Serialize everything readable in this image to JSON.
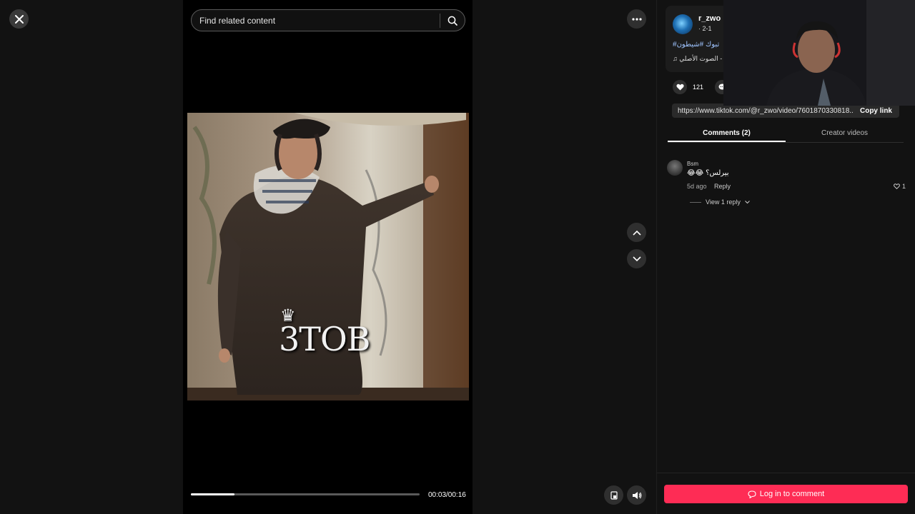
{
  "search": {
    "placeholder": "Find related content"
  },
  "player": {
    "watermark": "3TOB",
    "current_time": "00:03",
    "duration": "00:16",
    "time_label": "00:03/00:16",
    "progress": 0.19
  },
  "author": {
    "username": "r_zwo",
    "date": "· 2-1",
    "hashtags": "#تبوك #شيطون",
    "sound": "الصوت الأصلي -"
  },
  "stats": {
    "likes": "121"
  },
  "share": {
    "url": "https://www.tiktok.com/@r_zwo/video/7601870330818...",
    "copy_label": "Copy link"
  },
  "tabs": [
    {
      "label": "Comments (2)",
      "active": true
    },
    {
      "label": "Creator videos",
      "active": false
    }
  ],
  "comments": [
    {
      "user": "Bsm",
      "text": "😂😂 بيرلس؟",
      "age": "5d ago",
      "reply_label": "Reply",
      "likes": "1",
      "view_replies": "View 1 reply"
    }
  ],
  "login_label": "Log in to comment",
  "colors": {
    "accent": "#fe2c55",
    "background": "#121212",
    "video_bg": "#000000"
  },
  "icons": [
    "close-icon",
    "search-icon",
    "more-icon",
    "chevron-up-icon",
    "chevron-down-icon",
    "pip-icon",
    "volume-icon",
    "heart-icon",
    "comment-icon",
    "music-note-icon",
    "chat-icon"
  ]
}
